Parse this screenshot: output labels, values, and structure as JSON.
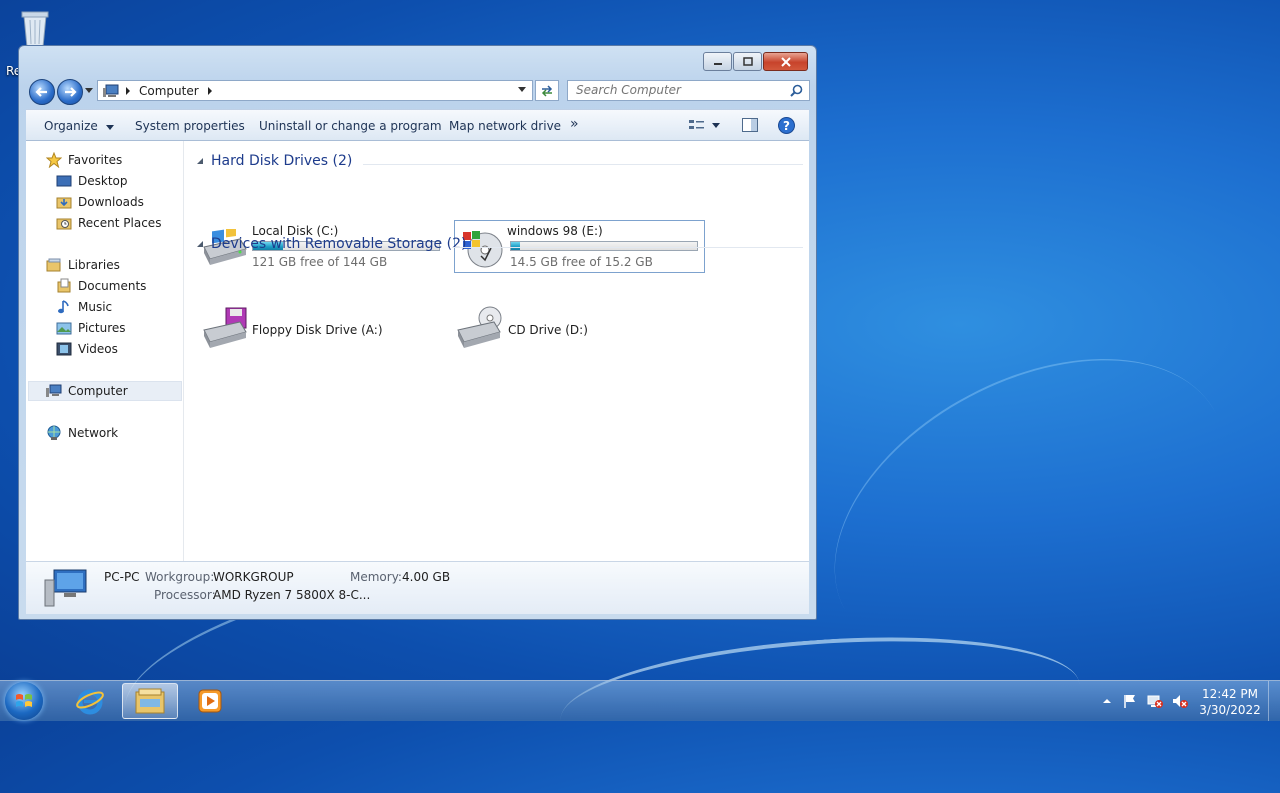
{
  "desktop": {
    "recycle_bin_label": "Re"
  },
  "window": {
    "address": {
      "root_label": "Computer"
    },
    "search": {
      "placeholder": "Search Computer"
    },
    "toolbar": {
      "organize": "Organize",
      "system_properties": "System properties",
      "uninstall": "Uninstall or change a program",
      "map_network_drive": "Map network drive",
      "more": "»"
    },
    "nav": {
      "favorites": "Favorites",
      "desktop": "Desktop",
      "downloads": "Downloads",
      "recent_places": "Recent Places",
      "libraries": "Libraries",
      "documents": "Documents",
      "music": "Music",
      "pictures": "Pictures",
      "videos": "Videos",
      "computer": "Computer",
      "network": "Network"
    },
    "groups": {
      "hard_disk": "Hard Disk Drives (2)",
      "removable": "Devices with Removable Storage (2)"
    },
    "drives": {
      "c": {
        "name": "Local Disk (C:)",
        "free": "121 GB free of 144 GB",
        "used_fraction": 0.16
      },
      "e": {
        "name": "windows 98 (E:)",
        "free": "14.5 GB free of 15.2 GB",
        "used_fraction": 0.05
      },
      "a": {
        "name": "Floppy Disk Drive (A:)"
      },
      "d": {
        "name": "CD Drive (D:)"
      }
    },
    "details": {
      "pc_name": "PC-PC",
      "workgroup_label": "Workgroup:",
      "workgroup": "WORKGROUP",
      "memory_label": "Memory:",
      "memory": "4.00 GB",
      "processor_label": "Processor:",
      "processor": "AMD Ryzen 7 5800X 8-C..."
    }
  },
  "taskbar": {
    "time": "12:42 PM",
    "date": "3/30/2022"
  }
}
